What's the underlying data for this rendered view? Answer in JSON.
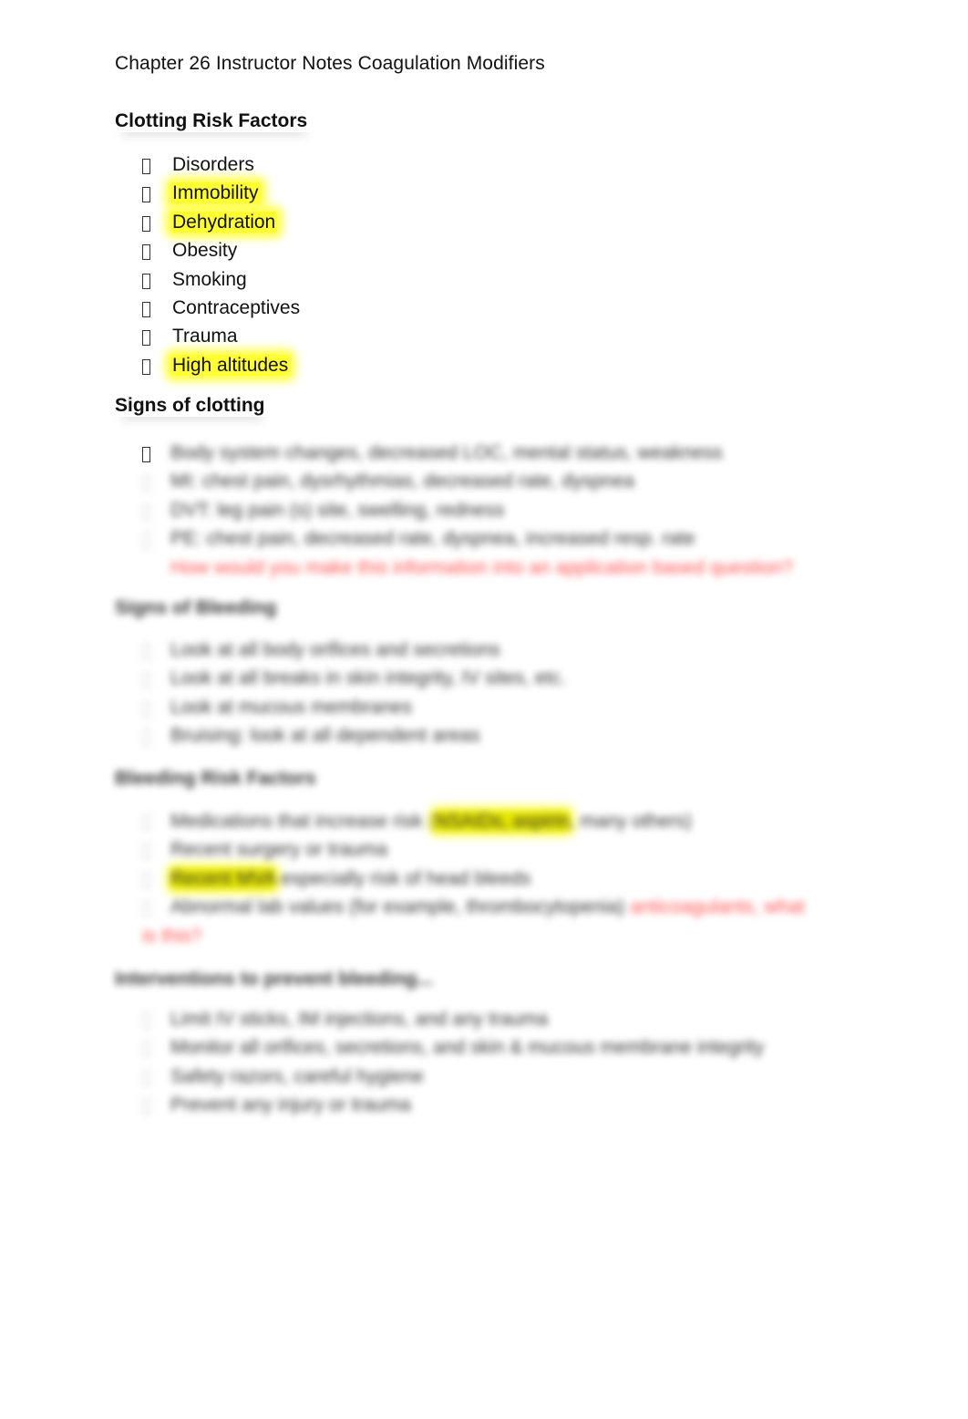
{
  "document": {
    "title": "Chapter 26 Instructor Notes  Coagulation Modifiers",
    "sections": [
      {
        "heading": "Clotting Risk Factors",
        "items": [
          {
            "text": "Disorders",
            "highlight": false
          },
          {
            "text": "Immobility",
            "highlight": true
          },
          {
            "text": "Dehydration",
            "highlight": true
          },
          {
            "text": "Obesity",
            "highlight": false
          },
          {
            "text": "Smoking",
            "highlight": false
          },
          {
            "text": "Contraceptives",
            "highlight": false
          },
          {
            "text": "Trauma",
            "highlight": false
          },
          {
            "text": "High altitudes",
            "highlight": true
          }
        ]
      },
      {
        "heading": "Signs of clotting",
        "items": [
          {
            "text": "Body system changes, decreased LOC, mental status, weakness"
          },
          {
            "text": "MI: chest pain, dysrhythmias, decreased rate, dyspnea"
          },
          {
            "text": "DVT: leg pain (s) site, swelling, redness"
          },
          {
            "text": "PE: chest pain, decreased rate, dyspnea, increased resp. rate"
          }
        ],
        "note": "How would you make this information into an application based question?"
      },
      {
        "heading": "Signs of Bleeding",
        "items": [
          {
            "text": "Look at all body orifices and secretions"
          },
          {
            "text": "Look at all breaks in skin integrity, IV sites, etc."
          },
          {
            "text": "Look at mucous membranes"
          },
          {
            "text": "Bruising: look at all dependent areas"
          }
        ]
      },
      {
        "heading": "Bleeding Risk Factors",
        "items": [
          {
            "before": "Medications that increase risk (",
            "highlight": "NSAIDs, aspirin",
            "after": ", many others)"
          },
          {
            "text": "Recent surgery or trauma"
          },
          {
            "highlight": "Recent MVA",
            "after": " especially risk of head bleeds"
          },
          {
            "before": "Abnormal lab values (for example, thrombocytopenia) ",
            "note": "anticoagulants, what is this?"
          }
        ]
      },
      {
        "heading": "Interventions to prevent bleeding...",
        "items": [
          {
            "text": "Limit IV sticks, IM injections, and any trauma"
          },
          {
            "text": "Monitor all orifices, secretions, and skin & mucous membrane integrity"
          },
          {
            "text": "Safety razors, careful hygiene"
          },
          {
            "text": "Prevent any injury or trauma"
          }
        ]
      }
    ]
  }
}
